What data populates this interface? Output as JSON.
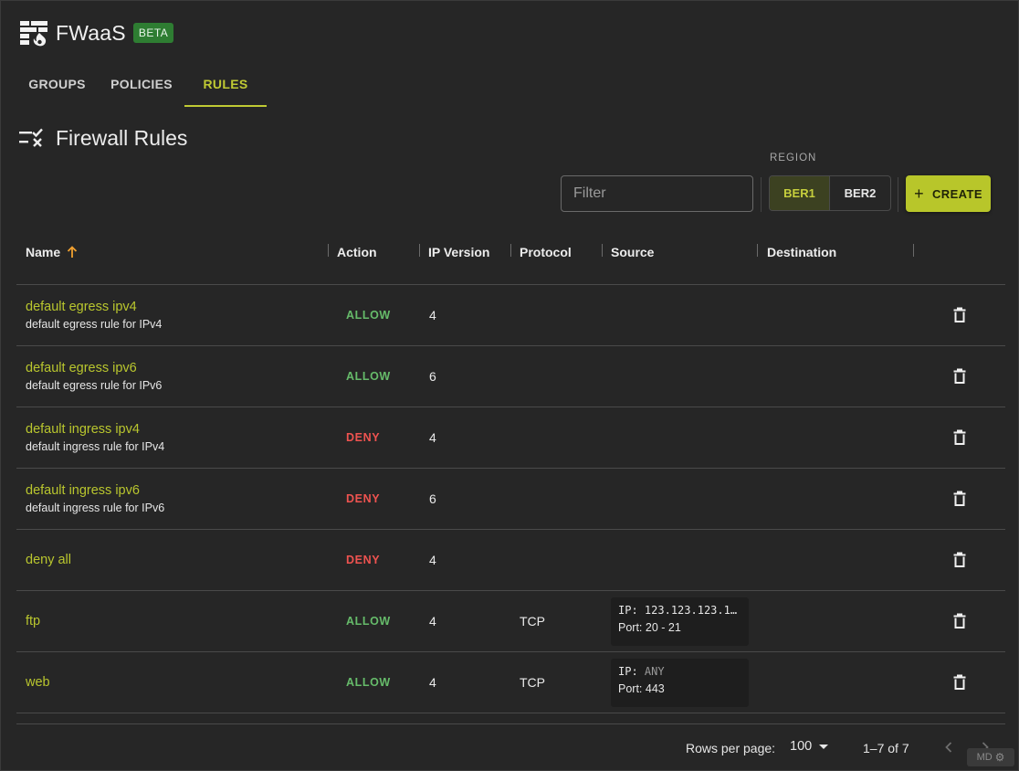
{
  "app": {
    "title": "FWaaS",
    "badge": "BETA"
  },
  "tabs": [
    {
      "label": "GROUPS",
      "active": false
    },
    {
      "label": "POLICIES",
      "active": false
    },
    {
      "label": "RULES",
      "active": true
    }
  ],
  "section": {
    "title": "Firewall Rules"
  },
  "toolbar": {
    "filter_placeholder": "Filter",
    "region_label": "REGION",
    "regions": [
      {
        "label": "BER1",
        "selected": true
      },
      {
        "label": "BER2",
        "selected": false
      }
    ],
    "create_label": "CREATE"
  },
  "table": {
    "columns": {
      "name": "Name",
      "action": "Action",
      "ip_version": "IP Version",
      "protocol": "Protocol",
      "source": "Source",
      "destination": "Destination"
    },
    "sort": {
      "column": "Name",
      "direction": "ascending"
    },
    "rows": [
      {
        "name": "default egress ipv4",
        "description": "default egress rule for IPv4",
        "action": "ALLOW",
        "ip_version": "4",
        "protocol": "",
        "source": null
      },
      {
        "name": "default egress ipv6",
        "description": "default egress rule for IPv6",
        "action": "ALLOW",
        "ip_version": "6",
        "protocol": "",
        "source": null
      },
      {
        "name": "default ingress ipv4",
        "description": "default ingress rule for IPv4",
        "action": "DENY",
        "ip_version": "4",
        "protocol": "",
        "source": null
      },
      {
        "name": "default ingress ipv6",
        "description": "default ingress rule for IPv6",
        "action": "DENY",
        "ip_version": "6",
        "protocol": "",
        "source": null
      },
      {
        "name": "deny all",
        "description": "",
        "action": "DENY",
        "ip_version": "4",
        "protocol": "",
        "source": null
      },
      {
        "name": "ftp",
        "description": "",
        "action": "ALLOW",
        "ip_version": "4",
        "protocol": "TCP",
        "source": {
          "ip_label": "IP:",
          "ip": "123.123.123.1…",
          "port": "Port: 20 - 21"
        }
      },
      {
        "name": "web",
        "description": "",
        "action": "ALLOW",
        "ip_version": "4",
        "protocol": "TCP",
        "source": {
          "ip_label": "IP:",
          "ip": "ANY",
          "port": "Port: 443"
        }
      }
    ]
  },
  "pagination": {
    "rows_per_page_label": "Rows per page:",
    "rows_per_page": "100",
    "range": "1–7 of 7"
  },
  "dev_badge": "MD",
  "colors": {
    "accent": "#c0ca33",
    "allow": "#66bb6a",
    "deny": "#ef5350",
    "beta": "#2e7d32",
    "background": "#262626"
  }
}
